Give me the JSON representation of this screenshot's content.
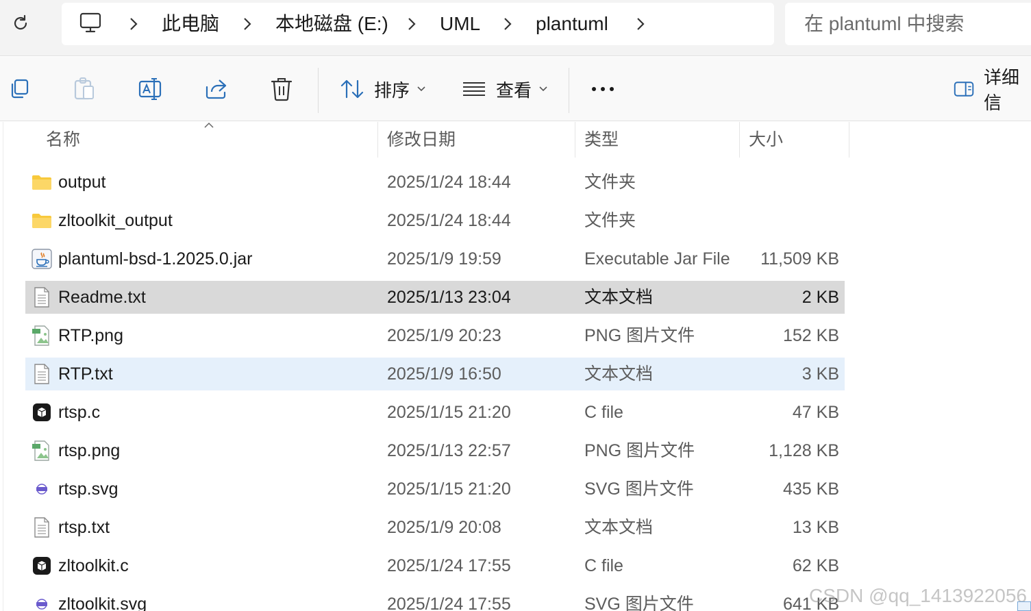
{
  "breadcrumb": {
    "items": [
      "此电脑",
      "本地磁盘 (E:)",
      "UML",
      "plantuml"
    ]
  },
  "search": {
    "placeholder": "在 plantuml 中搜索"
  },
  "toolbar": {
    "sort_label": "排序",
    "view_label": "查看",
    "details_label": "详细信"
  },
  "columns": {
    "name": "名称",
    "date": "修改日期",
    "type": "类型",
    "size": "大小"
  },
  "files": [
    {
      "name": "output",
      "date": "2025/1/24 18:44",
      "type": "文件夹",
      "size": "",
      "icon": "folder-icon"
    },
    {
      "name": "zltoolkit_output",
      "date": "2025/1/24 18:44",
      "type": "文件夹",
      "size": "",
      "icon": "folder-icon"
    },
    {
      "name": "plantuml-bsd-1.2025.0.jar",
      "date": "2025/1/9 19:59",
      "type": "Executable Jar File",
      "size": "11,509 KB",
      "icon": "java-jar-icon"
    },
    {
      "name": "Readme.txt",
      "date": "2025/1/13 23:04",
      "type": "文本文档",
      "size": "2 KB",
      "icon": "text-file-icon",
      "state": "selected"
    },
    {
      "name": "RTP.png",
      "date": "2025/1/9 20:23",
      "type": "PNG 图片文件",
      "size": "152 KB",
      "icon": "png-file-icon"
    },
    {
      "name": "RTP.txt",
      "date": "2025/1/9 16:50",
      "type": "文本文档",
      "size": "3 KB",
      "icon": "text-file-icon",
      "state": "hover"
    },
    {
      "name": "rtsp.c",
      "date": "2025/1/15 21:20",
      "type": "C file",
      "size": "47 KB",
      "icon": "c-file-icon"
    },
    {
      "name": "rtsp.png",
      "date": "2025/1/13 22:57",
      "type": "PNG 图片文件",
      "size": "1,128 KB",
      "icon": "png-file-icon"
    },
    {
      "name": "rtsp.svg",
      "date": "2025/1/15 21:20",
      "type": "SVG 图片文件",
      "size": "435 KB",
      "icon": "svg-file-icon"
    },
    {
      "name": "rtsp.txt",
      "date": "2025/1/9 20:08",
      "type": "文本文档",
      "size": "13 KB",
      "icon": "text-file-icon"
    },
    {
      "name": "zltoolkit.c",
      "date": "2025/1/24 17:55",
      "type": "C file",
      "size": "62 KB",
      "icon": "c-file-icon"
    },
    {
      "name": "zltoolkit.svg",
      "date": "2025/1/24 17:55",
      "type": "SVG 图片文件",
      "size": "641 KB",
      "icon": "svg-file-icon"
    }
  ],
  "watermark": "CSDN @qq_1413922056",
  "colors": {
    "selected_row": "#d9d9d9",
    "hover_row": "#e5f0fb",
    "folder": "#f8c93c",
    "accent": "#2a6fb8"
  }
}
